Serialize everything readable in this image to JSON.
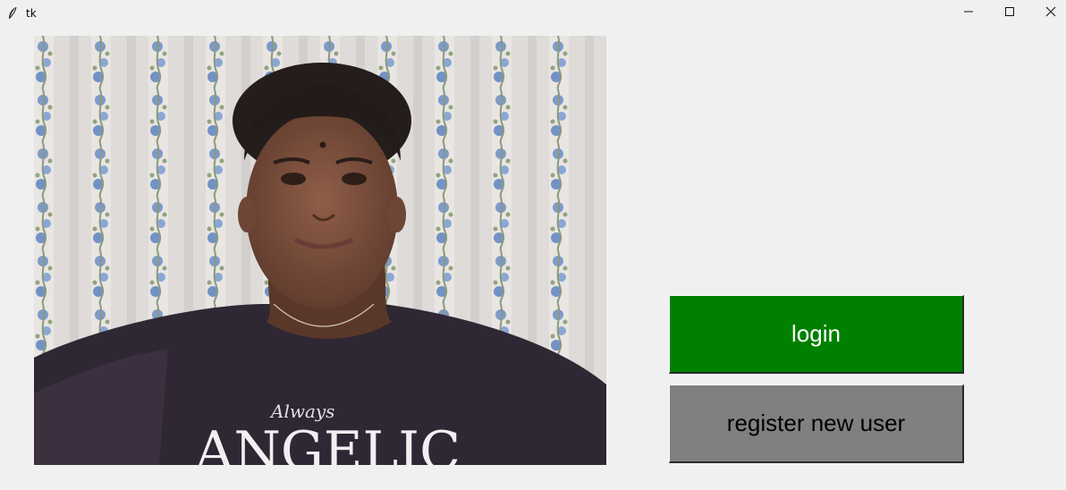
{
  "window": {
    "title": "tk",
    "icon": "feather-icon",
    "controls": [
      "minimize-icon",
      "maximize-icon",
      "close-icon"
    ]
  },
  "webcam": {
    "shirt_text_small": "Always",
    "shirt_text_large": "ANGELIC"
  },
  "buttons": {
    "login_label": "login",
    "login_color": "#008000",
    "register_label": "register new user",
    "register_color": "#808080"
  }
}
